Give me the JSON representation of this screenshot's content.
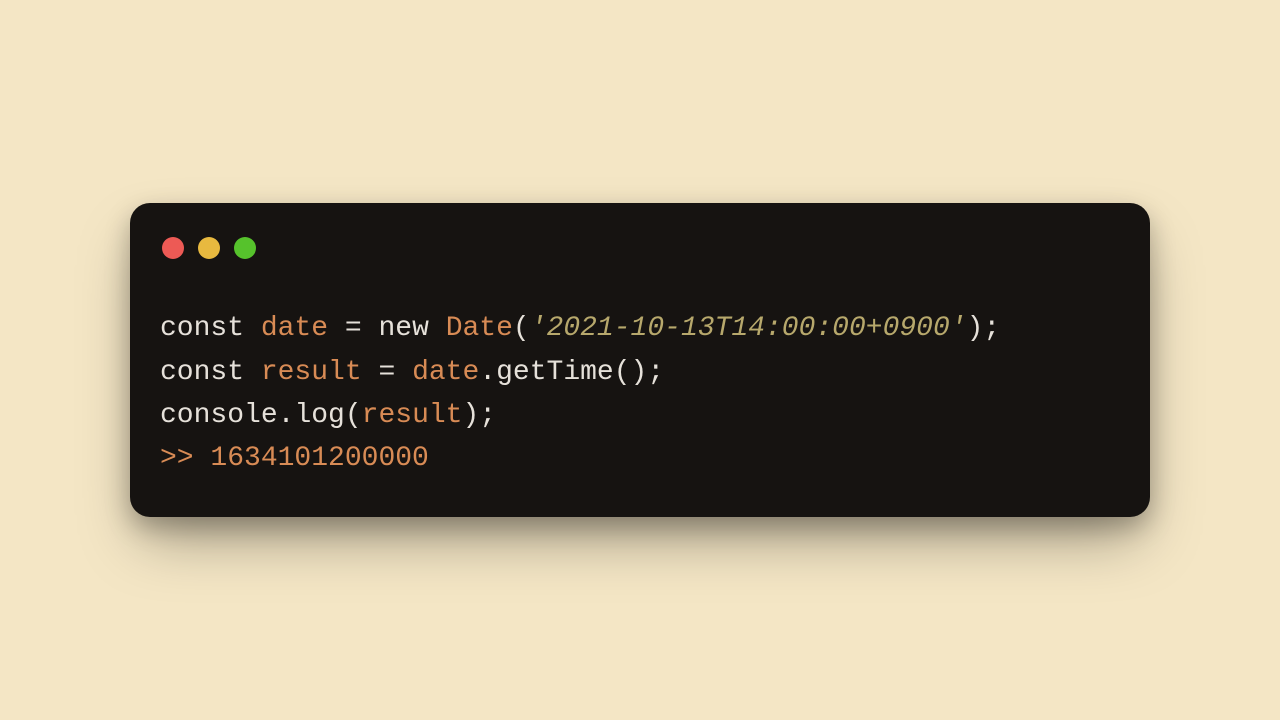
{
  "colors": {
    "page_bg": "#f4e6c5",
    "window_bg": "#161311",
    "dot_red": "#ed5a55",
    "dot_yellow": "#e8b93f",
    "dot_green": "#56c22c",
    "text_default": "#e6e1da",
    "text_ident": "#d88b55",
    "text_string": "#b7a86c"
  },
  "code": {
    "l1": {
      "a": "const ",
      "b": "date",
      "c": " = ",
      "d": "new ",
      "e": "Date",
      "f": "(",
      "g": "'2021-10-13T14:00:00+0900'",
      "h": ");"
    },
    "l2": {
      "a": "const ",
      "b": "result",
      "c": " = ",
      "d": "date",
      "e": ".",
      "f": "getTime",
      "g": "();"
    },
    "l3": {
      "a": "console",
      "b": ".",
      "c": "log",
      "d": "(",
      "e": "result",
      "f": ");"
    },
    "l4": {
      "a": ">> ",
      "b": "1634101200000"
    }
  }
}
